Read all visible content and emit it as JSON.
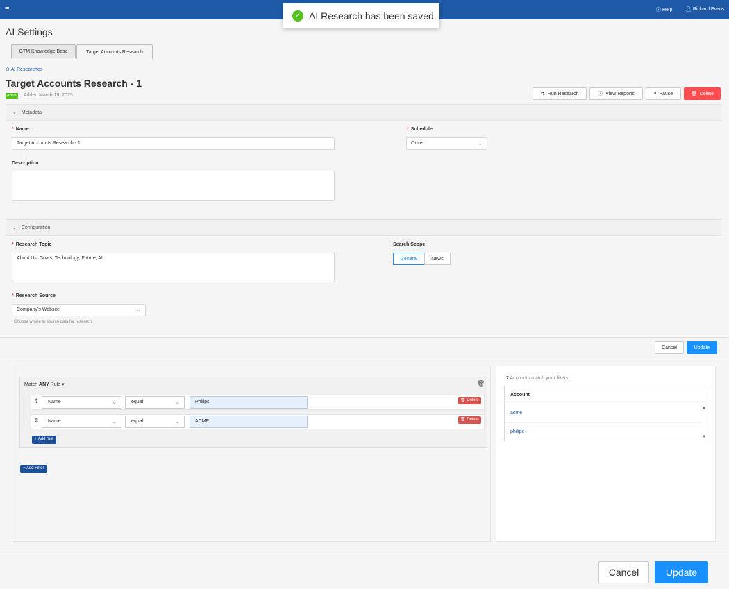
{
  "topbar": {
    "menu_icon": "hamburger-icon",
    "help": "Help",
    "user": "Richard Evans"
  },
  "toast": {
    "message": "AI Research has been saved."
  },
  "page": {
    "title": "AI Settings"
  },
  "tabs": [
    {
      "label": "GTM Knowledge Base"
    },
    {
      "label": "Target Accounts Research"
    }
  ],
  "back_link": "AI Researches",
  "research": {
    "title": "Target Accounts Research - 1",
    "status": "Active",
    "added": "Added March 19, 2025"
  },
  "actions": {
    "run": "Run Research",
    "view": "View Reports",
    "pause": "Pause",
    "delete": "Delete"
  },
  "metadata": {
    "header": "Metadata",
    "name_label": "Name",
    "name_value": "Target Accounts Research - 1",
    "schedule_label": "Schedule",
    "schedule_value": "Once",
    "description_label": "Description",
    "description_value": ""
  },
  "configuration": {
    "header": "Configuration",
    "topic_label": "Research Topic",
    "topic_value": "About Us, Goals, Technology, Future, AI",
    "scope_label": "Search Scope",
    "scope_options": [
      "General",
      "News"
    ],
    "scope_selected": "General",
    "source_label": "Research Source",
    "source_value": "Company's Website",
    "source_hint": "Choose where to source data for research"
  },
  "mid_buttons": {
    "cancel": "Cancel",
    "update": "Update"
  },
  "filters": {
    "match_prefix": "Match",
    "match_mode": "ANY",
    "match_suffix": "Rule",
    "rules": [
      {
        "field": "Name",
        "operator": "equal",
        "value": "Philips",
        "delete": "Delete"
      },
      {
        "field": "Name",
        "operator": "equal",
        "value": "ACME",
        "delete": "Delete"
      }
    ],
    "add_rule": "+ Add rule",
    "add_filter": "+ Add Filter"
  },
  "accounts": {
    "count": "2",
    "match_text": "Accounts match your filters.",
    "column": "Account",
    "rows": [
      "acme",
      "philips"
    ]
  },
  "bottom_buttons": {
    "cancel": "Cancel",
    "update": "Update"
  },
  "colors": {
    "brand": "#1e5aa8",
    "primary": "#1890ff",
    "danger": "#ff4d4f",
    "success": "#52c41a"
  }
}
